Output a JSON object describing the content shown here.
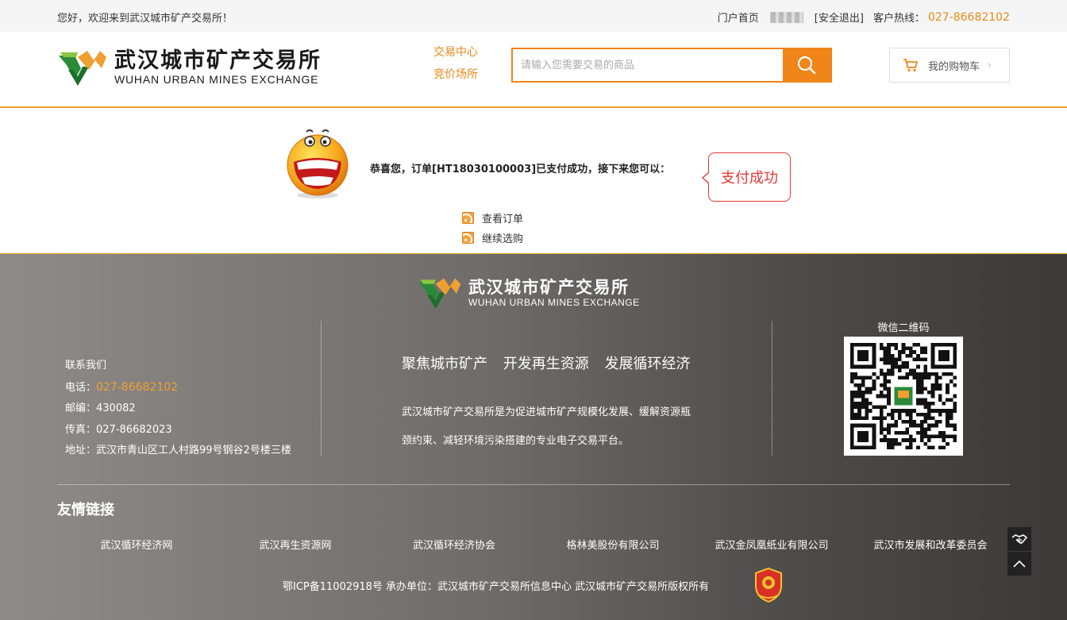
{
  "topbar": {
    "welcome": "您好，欢迎来到武汉城市矿产交易所！",
    "portal_home": "门户首页",
    "logout": "[安全退出]",
    "hotline_label": "客户热线：",
    "hotline_number": "027-86682102"
  },
  "header": {
    "logo_cn": "武汉城市矿产交易所",
    "logo_en": "WUHAN URBAN MINES EXCHANGE",
    "nav": [
      "交易中心",
      "竞价场所"
    ],
    "search_placeholder": "请输入您需要交易的商品",
    "cart_label": "我的购物车",
    "cart_chevron": "›"
  },
  "main": {
    "message": "恭喜您，订单[HT18030100003]已支付成功，接下来您可以：",
    "bubble": "支付成功",
    "actions": [
      "查看订单",
      "继续选购"
    ]
  },
  "footer": {
    "logo_cn": "武汉城市矿产交易所",
    "logo_en": "WUHAN URBAN MINES EXCHANGE",
    "contact_title": "联系我们",
    "phone_label": "电话：",
    "phone": "027-86682102",
    "postcode": "邮编：430082",
    "fax": "传真：027-86682023",
    "address": "地址：武汉市青山区工人村路99号钢谷2号楼三楼",
    "slogan": "聚焦城市矿产 开发再生资源 发展循环经济",
    "intro": "武汉城市矿产交易所是为促进城市矿产规模化发展、缓解资源瓶颈约束、减轻环境污染搭建的专业电子交易平台。",
    "qr_label": "微信二维码",
    "friend_title": "友情链接",
    "friend_links": [
      "武汉循环经济网",
      "武汉再生资源网",
      "武汉循环经济协会",
      "格林美股份有限公司",
      "武汉金凤凰纸业有限公司",
      "武汉市发展和改革委员会"
    ],
    "icp": "鄂ICP备11002918号  承办单位：武汉城市矿产交易所信息中心  武汉城市矿产交易所版权所有"
  },
  "colors": {
    "accent": "#f08519",
    "bubble_red": "#e53935"
  },
  "icons": {
    "search": "search-icon",
    "cart": "cart-icon",
    "rss": "rss-icon",
    "handshake": "handshake-icon",
    "top": "back-to-top-icon"
  }
}
